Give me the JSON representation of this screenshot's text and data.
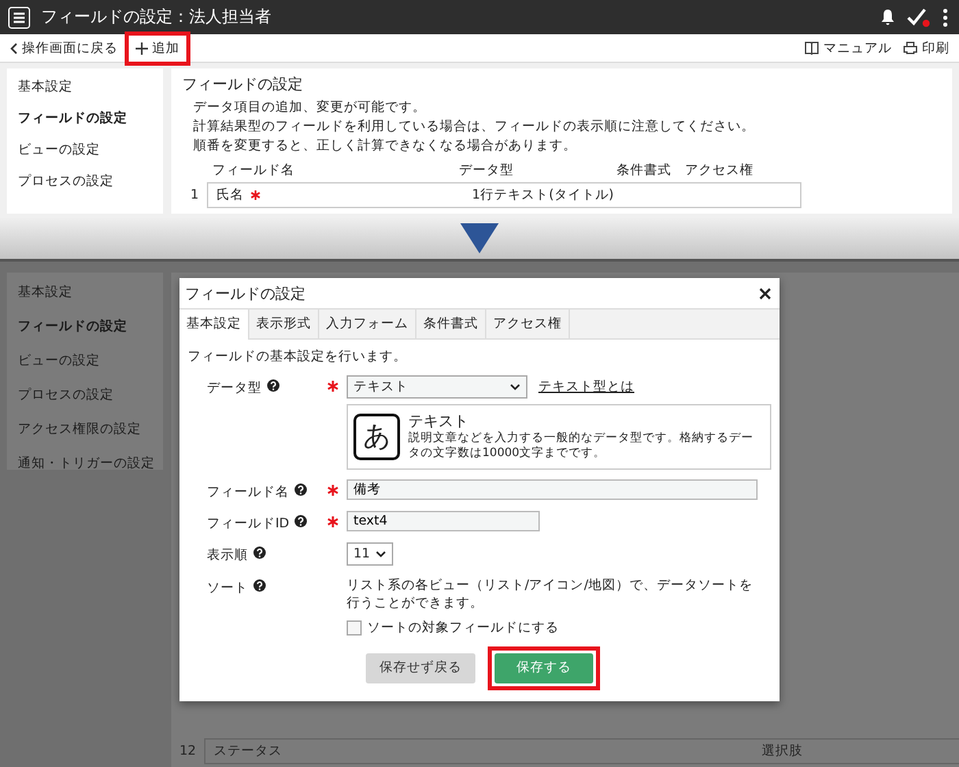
{
  "top": {
    "app_bar": {
      "title": "フィールドの設定：法人担当者"
    },
    "toolbar": {
      "back": "操作画面に戻る",
      "add": "追加",
      "add_highlighted": true,
      "manual": "マニュアル",
      "print": "印刷"
    },
    "sidebar": {
      "items": [
        {
          "label": "基本設定",
          "selected": false
        },
        {
          "label": "フィールドの設定",
          "selected": true
        },
        {
          "label": "ビューの設定",
          "selected": false
        },
        {
          "label": "プロセスの設定",
          "selected": false
        }
      ]
    },
    "main": {
      "title": "フィールドの設定",
      "description": [
        "データ項目の追加、変更が可能です。",
        "計算結果型のフィールドを利用している場合は、フィールドの表示順に注意してください。",
        "順番を変更すると、正しく計算できなくなる場合があります。"
      ],
      "columns": [
        "フィールド名",
        "データ型",
        "条件書式",
        "アクセス権"
      ],
      "rows": [
        {
          "number": "1",
          "name": "氏名",
          "required": true,
          "type": "1行テキスト(タイトル)"
        }
      ]
    }
  },
  "bottom": {
    "sidebar": {
      "items": [
        {
          "label": "基本設定",
          "selected": false
        },
        {
          "label": "フィールドの設定",
          "selected": true
        },
        {
          "label": "ビューの設定",
          "selected": false
        },
        {
          "label": "プロセスの設定",
          "selected": false
        },
        {
          "label": "アクセス権限の設定",
          "selected": false
        },
        {
          "label": "通知・トリガーの設定",
          "selected": false
        }
      ]
    },
    "rows": [
      {
        "number": "12",
        "name": "ステータス",
        "required": false,
        "type": "選択肢"
      }
    ],
    "dialog": {
      "title": "フィールドの設定",
      "tabs": [
        {
          "label": "基本設定",
          "selected": true
        },
        {
          "label": "表示形式",
          "selected": false
        },
        {
          "label": "入力フォーム",
          "selected": false
        },
        {
          "label": "条件書式",
          "selected": false
        },
        {
          "label": "アクセス権",
          "selected": false
        }
      ],
      "intro": "フィールドの基本設定を行います。",
      "fields": [
        {
          "kind": "select",
          "label": "データ型",
          "required": true,
          "value": "テキスト",
          "wide": true,
          "link": "テキスト型とは",
          "card": {
            "glyph": "あ",
            "name": "テキスト",
            "description": "説明文章などを入力する一般的なデータ型です。格納するデータの文字数は10000文字までです。"
          }
        },
        {
          "kind": "text",
          "label": "フィールド名",
          "required": true,
          "value": "備考",
          "wide": true
        },
        {
          "kind": "text",
          "label": "フィールドID",
          "required": true,
          "value": "text4",
          "wide": false
        },
        {
          "kind": "select",
          "label": "表示順",
          "required": false,
          "value": "11",
          "wide": false
        },
        {
          "kind": "checkbox",
          "label": "ソート",
          "required": false,
          "description": "リスト系の各ビュー（リスト/アイコン/地図）で、データソートを行うことができます。",
          "checkbox_label": "ソートの対象フィールドにする",
          "checked": false
        }
      ],
      "buttons": [
        {
          "label": "保存せず戻る",
          "kind": "secondary",
          "highlighted": false
        },
        {
          "label": "保存する",
          "kind": "primary",
          "highlighted": true
        }
      ]
    }
  }
}
